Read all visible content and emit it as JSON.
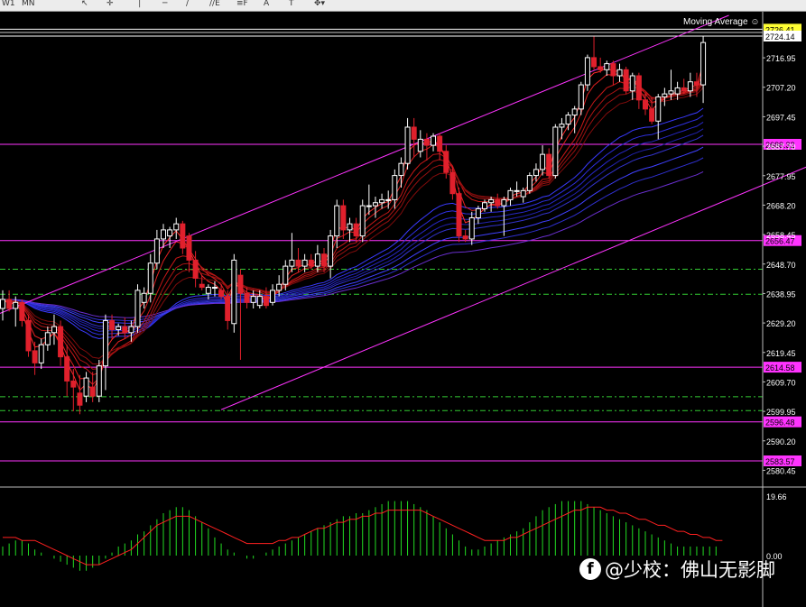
{
  "toolbar": {
    "items": [
      {
        "name": "tf-w1-label",
        "label": "W1"
      },
      {
        "name": "tf-mn-label",
        "label": "MN"
      },
      {
        "name": "cursor-icon",
        "label": "↖"
      },
      {
        "name": "crosshair-icon",
        "label": "✛"
      },
      {
        "name": "vertical-line-icon",
        "label": "│"
      },
      {
        "name": "horizontal-line-icon",
        "label": "─"
      },
      {
        "name": "trendline-icon",
        "label": "∕"
      },
      {
        "name": "equidistant-channel-icon",
        "label": "//E"
      },
      {
        "name": "fibonacci-icon",
        "label": "≡F"
      },
      {
        "name": "text-tool-icon",
        "label": "A"
      },
      {
        "name": "label-tool-icon",
        "label": "T"
      },
      {
        "name": "arrows-tool-icon",
        "label": "✥▾"
      }
    ]
  },
  "indicator": {
    "name": "Moving Average",
    "icon": "smiley-icon"
  },
  "watermark": {
    "text": "@少校：佛山无影脚",
    "icon": "facebook-like-icon"
  },
  "colors": {
    "bull": "#ffffff",
    "bear": "#e0202c",
    "level": "#ff33ff",
    "dash": "#33cc33",
    "bid_label": "#ffff33",
    "hist": "#22dd22",
    "signal": "#ff2020"
  },
  "chart_data": {
    "type": "candlestick",
    "price_axis": {
      "ticks": [
        "2716.95",
        "2707.20",
        "2697.45",
        "2687.70",
        "2677.95",
        "2668.20",
        "2658.45",
        "2648.70",
        "2638.95",
        "2629.20",
        "2619.45",
        "2609.70",
        "2599.95",
        "2590.20",
        "2580.45"
      ],
      "ylim": [
        2577.0,
        2731.0
      ]
    },
    "current_price_labels": [
      "2726.41",
      "2724.14"
    ],
    "horizontal_levels": [
      "2688.32",
      "2656.47",
      "2614.58",
      "2596.48",
      "2583.57"
    ],
    "dashed_levels": [
      2647.0,
      2638.7,
      2604.8,
      2600.2
    ],
    "channel_lines": [
      {
        "from": [
          -2,
          2631.0
        ],
        "to": [
          113,
          2731.0
        ]
      },
      {
        "from": [
          34,
          2600.5
        ],
        "to": [
          140,
          2694.0
        ]
      }
    ],
    "candles": [
      {
        "o": 2634,
        "h": 2640,
        "l": 2630,
        "c": 2637
      },
      {
        "o": 2637,
        "h": 2640,
        "l": 2633,
        "c": 2634
      },
      {
        "o": 2634,
        "h": 2638,
        "l": 2628,
        "c": 2636
      },
      {
        "o": 2636,
        "h": 2637,
        "l": 2628,
        "c": 2630
      },
      {
        "o": 2630,
        "h": 2632,
        "l": 2618,
        "c": 2620
      },
      {
        "o": 2620,
        "h": 2623,
        "l": 2612,
        "c": 2616
      },
      {
        "o": 2616,
        "h": 2624,
        "l": 2614,
        "c": 2622
      },
      {
        "o": 2622,
        "h": 2628,
        "l": 2620,
        "c": 2626
      },
      {
        "o": 2626,
        "h": 2632,
        "l": 2622,
        "c": 2628
      },
      {
        "o": 2628,
        "h": 2630,
        "l": 2615,
        "c": 2618
      },
      {
        "o": 2618,
        "h": 2622,
        "l": 2605,
        "c": 2610
      },
      {
        "o": 2610,
        "h": 2614,
        "l": 2600,
        "c": 2608
      },
      {
        "o": 2606,
        "h": 2612,
        "l": 2599,
        "c": 2602
      },
      {
        "o": 2605,
        "h": 2613,
        "l": 2603,
        "c": 2611
      },
      {
        "o": 2608,
        "h": 2613,
        "l": 2603,
        "c": 2605
      },
      {
        "o": 2605,
        "h": 2617,
        "l": 2603,
        "c": 2615
      },
      {
        "o": 2615,
        "h": 2632,
        "l": 2607,
        "c": 2630
      },
      {
        "o": 2630,
        "h": 2632,
        "l": 2624,
        "c": 2627
      },
      {
        "o": 2627,
        "h": 2629,
        "l": 2625,
        "c": 2628
      },
      {
        "o": 2628,
        "h": 2631,
        "l": 2624,
        "c": 2626
      },
      {
        "o": 2626,
        "h": 2630,
        "l": 2623,
        "c": 2628
      },
      {
        "o": 2628,
        "h": 2642,
        "l": 2626,
        "c": 2640
      },
      {
        "o": 2636,
        "h": 2641,
        "l": 2634,
        "c": 2639
      },
      {
        "o": 2639,
        "h": 2652,
        "l": 2636,
        "c": 2649
      },
      {
        "o": 2649,
        "h": 2660,
        "l": 2647,
        "c": 2657
      },
      {
        "o": 2657,
        "h": 2662,
        "l": 2654,
        "c": 2660
      },
      {
        "o": 2658,
        "h": 2661,
        "l": 2654,
        "c": 2660
      },
      {
        "o": 2660,
        "h": 2664,
        "l": 2657,
        "c": 2662
      },
      {
        "o": 2662,
        "h": 2663,
        "l": 2652,
        "c": 2654
      },
      {
        "o": 2658,
        "h": 2659,
        "l": 2646,
        "c": 2650
      },
      {
        "o": 2650,
        "h": 2653,
        "l": 2641,
        "c": 2644
      },
      {
        "o": 2642,
        "h": 2645,
        "l": 2640,
        "c": 2641
      },
      {
        "o": 2639,
        "h": 2642,
        "l": 2637,
        "c": 2641
      },
      {
        "o": 2641,
        "h": 2643,
        "l": 2638,
        "c": 2641
      },
      {
        "o": 2640,
        "h": 2642,
        "l": 2637,
        "c": 2638
      },
      {
        "o": 2638,
        "h": 2640,
        "l": 2627,
        "c": 2630
      },
      {
        "o": 2629,
        "h": 2652,
        "l": 2626,
        "c": 2650
      },
      {
        "o": 2645,
        "h": 2647,
        "l": 2617,
        "c": 2639
      },
      {
        "o": 2639,
        "h": 2641,
        "l": 2634,
        "c": 2636
      },
      {
        "o": 2636,
        "h": 2640,
        "l": 2634,
        "c": 2638
      },
      {
        "o": 2635,
        "h": 2640,
        "l": 2634,
        "c": 2638
      },
      {
        "o": 2638,
        "h": 2641,
        "l": 2634,
        "c": 2635
      },
      {
        "o": 2636,
        "h": 2642,
        "l": 2635,
        "c": 2640
      },
      {
        "o": 2640,
        "h": 2645,
        "l": 2638,
        "c": 2642
      },
      {
        "o": 2642,
        "h": 2650,
        "l": 2640,
        "c": 2648
      },
      {
        "o": 2648,
        "h": 2659,
        "l": 2646,
        "c": 2650
      },
      {
        "o": 2650,
        "h": 2654,
        "l": 2646,
        "c": 2648
      },
      {
        "o": 2648,
        "h": 2652,
        "l": 2646,
        "c": 2650
      },
      {
        "o": 2650,
        "h": 2652,
        "l": 2647,
        "c": 2648
      },
      {
        "o": 2648,
        "h": 2655,
        "l": 2646,
        "c": 2652
      },
      {
        "o": 2652,
        "h": 2654,
        "l": 2646,
        "c": 2648
      },
      {
        "o": 2648,
        "h": 2660,
        "l": 2644,
        "c": 2658
      },
      {
        "o": 2658,
        "h": 2670,
        "l": 2654,
        "c": 2668
      },
      {
        "o": 2668,
        "h": 2670,
        "l": 2657,
        "c": 2660
      },
      {
        "o": 2660,
        "h": 2664,
        "l": 2656,
        "c": 2662
      },
      {
        "o": 2662,
        "h": 2664,
        "l": 2656,
        "c": 2658
      },
      {
        "o": 2658,
        "h": 2670,
        "l": 2656,
        "c": 2668
      },
      {
        "o": 2668,
        "h": 2675,
        "l": 2665,
        "c": 2668
      },
      {
        "o": 2668,
        "h": 2671,
        "l": 2664,
        "c": 2669
      },
      {
        "o": 2669,
        "h": 2672,
        "l": 2667,
        "c": 2670
      },
      {
        "o": 2670,
        "h": 2673,
        "l": 2667,
        "c": 2670
      },
      {
        "o": 2670,
        "h": 2680,
        "l": 2667,
        "c": 2678
      },
      {
        "o": 2678,
        "h": 2684,
        "l": 2674,
        "c": 2682
      },
      {
        "o": 2682,
        "h": 2697,
        "l": 2680,
        "c": 2694
      },
      {
        "o": 2694,
        "h": 2697,
        "l": 2684,
        "c": 2690
      },
      {
        "o": 2686,
        "h": 2693,
        "l": 2684,
        "c": 2690
      },
      {
        "o": 2690,
        "h": 2692,
        "l": 2683,
        "c": 2688
      },
      {
        "o": 2688,
        "h": 2692,
        "l": 2686,
        "c": 2691
      },
      {
        "o": 2691,
        "h": 2692,
        "l": 2683,
        "c": 2686
      },
      {
        "o": 2686,
        "h": 2688,
        "l": 2677,
        "c": 2679
      },
      {
        "o": 2679,
        "h": 2681,
        "l": 2670,
        "c": 2672
      },
      {
        "o": 2672,
        "h": 2674,
        "l": 2656,
        "c": 2658
      },
      {
        "o": 2658,
        "h": 2660,
        "l": 2656,
        "c": 2657
      },
      {
        "o": 2657,
        "h": 2666,
        "l": 2655,
        "c": 2664
      },
      {
        "o": 2664,
        "h": 2668,
        "l": 2662,
        "c": 2667
      },
      {
        "o": 2667,
        "h": 2670,
        "l": 2666,
        "c": 2669
      },
      {
        "o": 2669,
        "h": 2671,
        "l": 2666,
        "c": 2670
      },
      {
        "o": 2670,
        "h": 2672,
        "l": 2667,
        "c": 2668
      },
      {
        "o": 2668,
        "h": 2671,
        "l": 2658,
        "c": 2670
      },
      {
        "o": 2670,
        "h": 2674,
        "l": 2668,
        "c": 2673
      },
      {
        "o": 2673,
        "h": 2676,
        "l": 2671,
        "c": 2673
      },
      {
        "o": 2671,
        "h": 2674,
        "l": 2669,
        "c": 2673
      },
      {
        "o": 2673,
        "h": 2679,
        "l": 2672,
        "c": 2678
      },
      {
        "o": 2678,
        "h": 2682,
        "l": 2676,
        "c": 2680
      },
      {
        "o": 2680,
        "h": 2688,
        "l": 2678,
        "c": 2685
      },
      {
        "o": 2685,
        "h": 2687,
        "l": 2677,
        "c": 2678
      },
      {
        "o": 2678,
        "h": 2695,
        "l": 2677,
        "c": 2694
      },
      {
        "o": 2694,
        "h": 2697,
        "l": 2690,
        "c": 2695
      },
      {
        "o": 2695,
        "h": 2699,
        "l": 2693,
        "c": 2698
      },
      {
        "o": 2698,
        "h": 2701,
        "l": 2692,
        "c": 2700
      },
      {
        "o": 2700,
        "h": 2709,
        "l": 2698,
        "c": 2708
      },
      {
        "o": 2708,
        "h": 2718,
        "l": 2706,
        "c": 2717
      },
      {
        "o": 2717,
        "h": 2724,
        "l": 2713,
        "c": 2714
      },
      {
        "o": 2714,
        "h": 2717,
        "l": 2712,
        "c": 2713
      },
      {
        "o": 2713,
        "h": 2716,
        "l": 2711,
        "c": 2715
      },
      {
        "o": 2715,
        "h": 2716,
        "l": 2708,
        "c": 2711
      },
      {
        "o": 2711,
        "h": 2715,
        "l": 2709,
        "c": 2713
      },
      {
        "o": 2713,
        "h": 2714,
        "l": 2705,
        "c": 2706
      },
      {
        "o": 2706,
        "h": 2712,
        "l": 2703,
        "c": 2711
      },
      {
        "o": 2711,
        "h": 2712,
        "l": 2700,
        "c": 2703
      },
      {
        "o": 2703,
        "h": 2705,
        "l": 2698,
        "c": 2700
      },
      {
        "o": 2700,
        "h": 2704,
        "l": 2695,
        "c": 2696
      },
      {
        "o": 2696,
        "h": 2705,
        "l": 2690,
        "c": 2704
      },
      {
        "o": 2704,
        "h": 2707,
        "l": 2701,
        "c": 2705
      },
      {
        "o": 2705,
        "h": 2713,
        "l": 2703,
        "c": 2706
      },
      {
        "o": 2705,
        "h": 2709,
        "l": 2703,
        "c": 2707
      },
      {
        "o": 2707,
        "h": 2710,
        "l": 2705,
        "c": 2706
      },
      {
        "o": 2706,
        "h": 2712,
        "l": 2704,
        "c": 2709
      },
      {
        "o": 2709,
        "h": 2712,
        "l": 2704,
        "c": 2708
      },
      {
        "o": 2708,
        "h": 2724,
        "l": 2702,
        "c": 2722
      }
    ],
    "oscillator": {
      "axis_labels": [
        "19.66",
        "0.00"
      ],
      "histogram": [
        3,
        4,
        5,
        5,
        4,
        2,
        1,
        0,
        -1,
        -2,
        -3,
        -4,
        -5,
        -5,
        -4,
        -3,
        -1,
        1,
        3,
        4,
        5,
        7,
        8,
        10,
        12,
        14,
        15,
        16,
        16,
        15,
        13,
        11,
        9,
        6,
        4,
        2,
        1,
        0,
        -1,
        -1,
        0,
        1,
        2,
        3,
        4,
        5,
        6,
        7,
        8,
        9,
        10,
        11,
        12,
        13,
        13,
        14,
        14,
        15,
        16,
        17,
        18,
        18,
        18,
        18,
        17,
        16,
        15,
        13,
        11,
        9,
        7,
        5,
        3,
        2,
        2,
        3,
        4,
        5,
        6,
        7,
        8,
        9,
        11,
        13,
        15,
        16,
        17,
        18,
        18,
        18,
        18,
        17,
        16,
        15,
        14,
        13,
        12,
        11,
        10,
        9,
        8,
        7,
        6,
        5,
        4,
        3,
        3,
        3,
        3,
        3,
        3,
        3
      ],
      "signal": [
        6,
        6,
        6,
        5,
        5,
        5,
        4,
        3,
        2,
        1,
        0,
        -1,
        -2,
        -3,
        -3,
        -3,
        -2,
        -1,
        0,
        1,
        2,
        4,
        6,
        8,
        10,
        11,
        12,
        13,
        13,
        13,
        12,
        11,
        10,
        9,
        8,
        7,
        6,
        5,
        4,
        4,
        4,
        4,
        4,
        5,
        5,
        6,
        6,
        7,
        8,
        9,
        9,
        10,
        11,
        11,
        12,
        12,
        13,
        13,
        14,
        14,
        15,
        15,
        15,
        15,
        15,
        15,
        14,
        13,
        12,
        11,
        10,
        9,
        8,
        7,
        6,
        5,
        5,
        5,
        5,
        6,
        6,
        7,
        8,
        9,
        10,
        11,
        12,
        13,
        14,
        15,
        15,
        16,
        16,
        16,
        15,
        15,
        14,
        14,
        13,
        12,
        12,
        11,
        10,
        10,
        9,
        8,
        8,
        7,
        7,
        6,
        6,
        5,
        5
      ]
    }
  }
}
